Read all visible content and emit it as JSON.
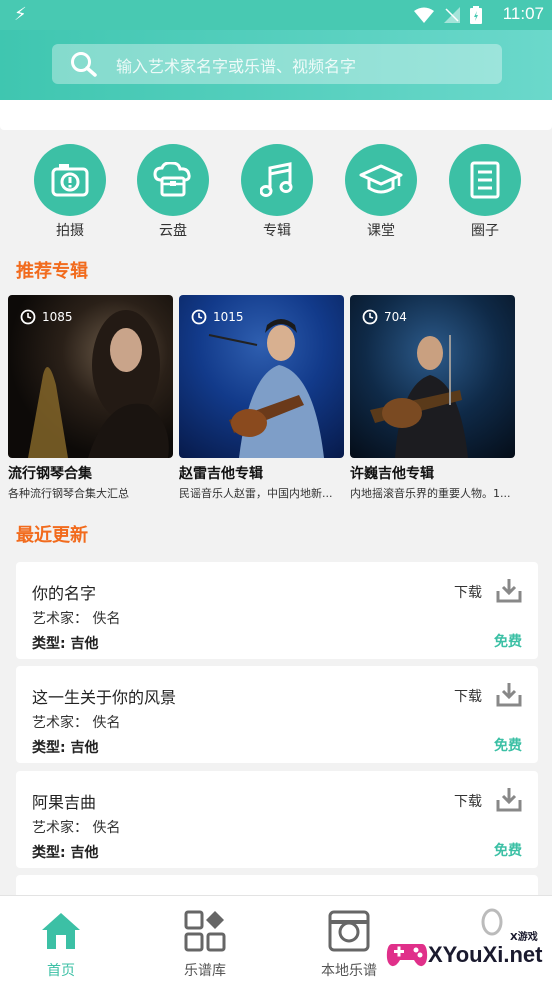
{
  "status_bar": {
    "time": "11:07"
  },
  "search": {
    "placeholder": "输入艺术家名字或乐谱、视频名字"
  },
  "quick_actions": [
    {
      "label": "拍摄",
      "icon": "camera-icon"
    },
    {
      "label": "云盘",
      "icon": "cloud-drive-icon"
    },
    {
      "label": "专辑",
      "icon": "music-note-icon"
    },
    {
      "label": "课堂",
      "icon": "graduation-cap-icon"
    },
    {
      "label": "圈子",
      "icon": "document-list-icon"
    }
  ],
  "sections": {
    "recommended": "推荐专辑",
    "recent": "最近更新"
  },
  "albums": [
    {
      "count": "1085",
      "title": "流行钢琴合集",
      "desc": "各种流行钢琴合集大汇总"
    },
    {
      "count": "1015",
      "title": "赵雷吉他专辑",
      "desc": "民谣音乐人赵雷，中国内地新..."
    },
    {
      "count": "704",
      "title": "许巍吉他专辑",
      "desc": "内地摇滚音乐界的重要人物。1..."
    }
  ],
  "recent": [
    {
      "title": "你的名字",
      "artist": "艺术家：  佚名",
      "type": "类型: 吉他",
      "download": "下载",
      "price": "免费"
    },
    {
      "title": "这一生关于你的风景",
      "artist": "艺术家：  佚名",
      "type": "类型: 吉他",
      "download": "下载",
      "price": "免费"
    },
    {
      "title": "阿果吉曲",
      "artist": "艺术家：  佚名",
      "type": "类型: 吉他",
      "download": "下载",
      "price": "免费"
    }
  ],
  "nav": [
    {
      "label": "首页",
      "active": true
    },
    {
      "label": "乐谱库",
      "active": false
    },
    {
      "label": "本地乐谱",
      "active": false
    }
  ],
  "watermark": {
    "text": "XYouXi.net",
    "small": "X游戏"
  },
  "colors": {
    "accent": "#3cc0a5",
    "section_title": "#f26b1d",
    "header": "#48c9b2"
  }
}
